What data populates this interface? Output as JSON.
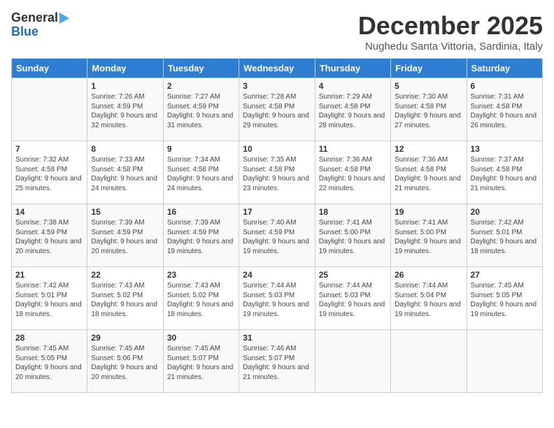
{
  "header": {
    "logo_line1": "General",
    "logo_line2": "Blue",
    "month": "December 2025",
    "location": "Nughedu Santa Vittoria, Sardinia, Italy"
  },
  "days_of_week": [
    "Sunday",
    "Monday",
    "Tuesday",
    "Wednesday",
    "Thursday",
    "Friday",
    "Saturday"
  ],
  "weeks": [
    [
      {
        "day": "",
        "content": ""
      },
      {
        "day": "1",
        "content": "Sunrise: 7:26 AM\nSunset: 4:59 PM\nDaylight: 9 hours and 32 minutes."
      },
      {
        "day": "2",
        "content": "Sunrise: 7:27 AM\nSunset: 4:59 PM\nDaylight: 9 hours and 31 minutes."
      },
      {
        "day": "3",
        "content": "Sunrise: 7:28 AM\nSunset: 4:58 PM\nDaylight: 9 hours and 29 minutes."
      },
      {
        "day": "4",
        "content": "Sunrise: 7:29 AM\nSunset: 4:58 PM\nDaylight: 9 hours and 28 minutes."
      },
      {
        "day": "5",
        "content": "Sunrise: 7:30 AM\nSunset: 4:58 PM\nDaylight: 9 hours and 27 minutes."
      },
      {
        "day": "6",
        "content": "Sunrise: 7:31 AM\nSunset: 4:58 PM\nDaylight: 9 hours and 26 minutes."
      }
    ],
    [
      {
        "day": "7",
        "content": "Sunrise: 7:32 AM\nSunset: 4:58 PM\nDaylight: 9 hours and 25 minutes."
      },
      {
        "day": "8",
        "content": "Sunrise: 7:33 AM\nSunset: 4:58 PM\nDaylight: 9 hours and 24 minutes."
      },
      {
        "day": "9",
        "content": "Sunrise: 7:34 AM\nSunset: 4:58 PM\nDaylight: 9 hours and 24 minutes."
      },
      {
        "day": "10",
        "content": "Sunrise: 7:35 AM\nSunset: 4:58 PM\nDaylight: 9 hours and 23 minutes."
      },
      {
        "day": "11",
        "content": "Sunrise: 7:36 AM\nSunset: 4:58 PM\nDaylight: 9 hours and 22 minutes."
      },
      {
        "day": "12",
        "content": "Sunrise: 7:36 AM\nSunset: 4:58 PM\nDaylight: 9 hours and 21 minutes."
      },
      {
        "day": "13",
        "content": "Sunrise: 7:37 AM\nSunset: 4:58 PM\nDaylight: 9 hours and 21 minutes."
      }
    ],
    [
      {
        "day": "14",
        "content": "Sunrise: 7:38 AM\nSunset: 4:59 PM\nDaylight: 9 hours and 20 minutes."
      },
      {
        "day": "15",
        "content": "Sunrise: 7:39 AM\nSunset: 4:59 PM\nDaylight: 9 hours and 20 minutes."
      },
      {
        "day": "16",
        "content": "Sunrise: 7:39 AM\nSunset: 4:59 PM\nDaylight: 9 hours and 19 minutes."
      },
      {
        "day": "17",
        "content": "Sunrise: 7:40 AM\nSunset: 4:59 PM\nDaylight: 9 hours and 19 minutes."
      },
      {
        "day": "18",
        "content": "Sunrise: 7:41 AM\nSunset: 5:00 PM\nDaylight: 9 hours and 19 minutes."
      },
      {
        "day": "19",
        "content": "Sunrise: 7:41 AM\nSunset: 5:00 PM\nDaylight: 9 hours and 19 minutes."
      },
      {
        "day": "20",
        "content": "Sunrise: 7:42 AM\nSunset: 5:01 PM\nDaylight: 9 hours and 18 minutes."
      }
    ],
    [
      {
        "day": "21",
        "content": "Sunrise: 7:42 AM\nSunset: 5:01 PM\nDaylight: 9 hours and 18 minutes."
      },
      {
        "day": "22",
        "content": "Sunrise: 7:43 AM\nSunset: 5:02 PM\nDaylight: 9 hours and 18 minutes."
      },
      {
        "day": "23",
        "content": "Sunrise: 7:43 AM\nSunset: 5:02 PM\nDaylight: 9 hours and 18 minutes."
      },
      {
        "day": "24",
        "content": "Sunrise: 7:44 AM\nSunset: 5:03 PM\nDaylight: 9 hours and 19 minutes."
      },
      {
        "day": "25",
        "content": "Sunrise: 7:44 AM\nSunset: 5:03 PM\nDaylight: 9 hours and 19 minutes."
      },
      {
        "day": "26",
        "content": "Sunrise: 7:44 AM\nSunset: 5:04 PM\nDaylight: 9 hours and 19 minutes."
      },
      {
        "day": "27",
        "content": "Sunrise: 7:45 AM\nSunset: 5:05 PM\nDaylight: 9 hours and 19 minutes."
      }
    ],
    [
      {
        "day": "28",
        "content": "Sunrise: 7:45 AM\nSunset: 5:05 PM\nDaylight: 9 hours and 20 minutes."
      },
      {
        "day": "29",
        "content": "Sunrise: 7:45 AM\nSunset: 5:06 PM\nDaylight: 9 hours and 20 minutes."
      },
      {
        "day": "30",
        "content": "Sunrise: 7:45 AM\nSunset: 5:07 PM\nDaylight: 9 hours and 21 minutes."
      },
      {
        "day": "31",
        "content": "Sunrise: 7:46 AM\nSunset: 5:07 PM\nDaylight: 9 hours and 21 minutes."
      },
      {
        "day": "",
        "content": ""
      },
      {
        "day": "",
        "content": ""
      },
      {
        "day": "",
        "content": ""
      }
    ]
  ]
}
